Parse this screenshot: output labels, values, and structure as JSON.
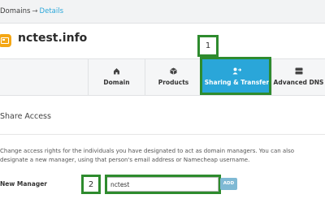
{
  "breadcrumb": {
    "parent": "Domains",
    "separator": "→",
    "current": "Details"
  },
  "domain": {
    "name": "nctest.info"
  },
  "callouts": [
    "1",
    "2"
  ],
  "tabs": [
    {
      "label": "Domain",
      "icon": "home-icon",
      "active": false
    },
    {
      "label": "Products",
      "icon": "box-icon",
      "active": false
    },
    {
      "label": "Sharing & Transfer",
      "icon": "user-transfer-icon",
      "active": true
    },
    {
      "label": "Advanced DNS",
      "icon": "server-icon",
      "active": false
    }
  ],
  "section": {
    "title": "Share Access",
    "description": "Change access rights for the individuals you have designated to act as domain managers. You can also designate a new manager, using that person's email address or Namecheap username."
  },
  "new_manager": {
    "label": "New Manager",
    "value": "nctest",
    "add_label": "ADD"
  },
  "colors": {
    "accent": "#2aa6d9",
    "highlight": "#2e8b2e",
    "domain_icon": "#f4a614"
  }
}
